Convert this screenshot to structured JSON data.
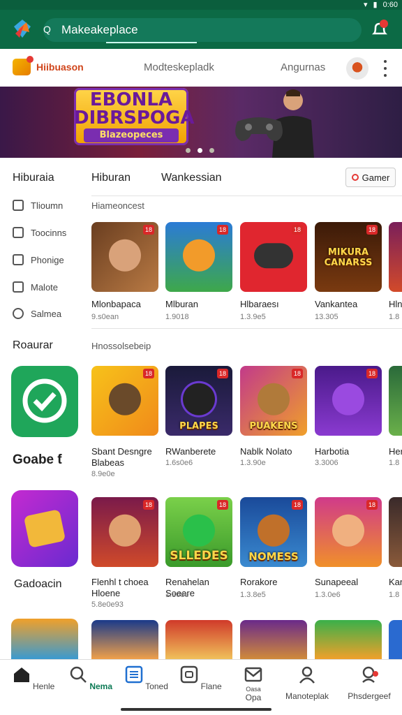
{
  "status": {
    "time": "0:60"
  },
  "topbar": {
    "search_prefix": "Q",
    "search_value": "Makeakeplace"
  },
  "appbar": {
    "brand": "Hiibuason",
    "mid": "Modteskepladk",
    "right": "Angurnas"
  },
  "banner": {
    "line1": "EBONLA",
    "line2": "DIBRSPOGA",
    "line3": "Blazeopeces"
  },
  "tabs": {
    "sidebar_title": "Hiburaia",
    "tab1": "Hiburan",
    "tab2": "Wankessian",
    "game_button": "Gamer"
  },
  "sidebar": {
    "items": [
      "Tlioumn",
      "Toocinns",
      "Phonige",
      "Malote",
      "Salmea"
    ],
    "section2": "Roaurar"
  },
  "row1": {
    "subhead": "Hiameoncest",
    "games": [
      {
        "name": "Mlonbapaca",
        "sub": "9.s0ean",
        "badge": "18"
      },
      {
        "name": "Mlburan",
        "sub": "1.9018",
        "badge": "18"
      },
      {
        "name": "Hlbaraesı",
        "sub": "1.3.9e5",
        "badge": "18"
      },
      {
        "name": "Vankantea",
        "sub": "13.305",
        "badge": "18",
        "art": "MIKURA CANARSS"
      },
      {
        "name": "Hln",
        "sub": "1.8",
        "badge": ""
      }
    ]
  },
  "row2": {
    "subhead": "Hnossolsebeip",
    "left_title": "Goabe ƭ",
    "games": [
      {
        "name": "Sbant Desngre\nBlabeas",
        "sub": "8.9e0e",
        "badge": "18"
      },
      {
        "name": "RWanberete",
        "sub": "1.6s0e6",
        "badge": "18",
        "art": "PLAPES"
      },
      {
        "name": "Nablk Nolato",
        "sub": "1.3.90e",
        "badge": "18",
        "art": "PUAKENS"
      },
      {
        "name": "Harbotia",
        "sub": "3.3006",
        "badge": "18"
      },
      {
        "name": "Her",
        "sub": "1.8",
        "badge": ""
      }
    ]
  },
  "row3": {
    "left_title": "Gadoacin",
    "games": [
      {
        "name": "Flenhl t choea\nHloene",
        "sub": "5.8e0e93",
        "badge": "18"
      },
      {
        "name": "Renahelan\nSoeare",
        "sub": "1.80oe",
        "badge": "18",
        "art": "SLLEDES"
      },
      {
        "name": "Rorakore",
        "sub": "1.3.8e5",
        "badge": "18",
        "art": "NOMESS"
      },
      {
        "name": "Sunapeeal",
        "sub": "1.3.0e6",
        "badge": "18"
      },
      {
        "name": "Kar",
        "sub": "1.8",
        "badge": ""
      }
    ]
  },
  "bottomnav": [
    {
      "label": "Henle"
    },
    {
      "label": "Nema"
    },
    {
      "label": "Toned"
    },
    {
      "label": "Flane"
    },
    {
      "label": "Opa",
      "sublabel": "Oasa"
    },
    {
      "label": "Manoteplak"
    },
    {
      "label": "Phsdergeef"
    }
  ],
  "colors": {
    "primary": "#0c6a45",
    "accent": "#0c7a55",
    "badge": "#d92828"
  }
}
